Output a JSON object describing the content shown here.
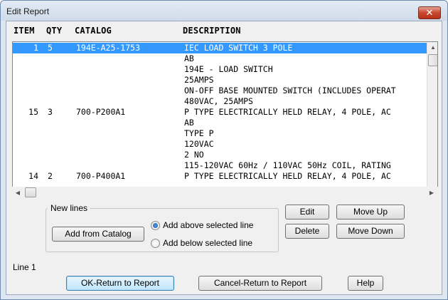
{
  "window": {
    "title": "Edit Report",
    "close_glyph": "✕"
  },
  "columns": {
    "item": "ITEM",
    "qty": "QTY",
    "catalog": "CATALOG",
    "description": "DESCRIPTION"
  },
  "rows": [
    {
      "item": "1",
      "qty": "5",
      "catalog": "194E-A25-1753",
      "description": "IEC LOAD SWITCH 3 POLE",
      "selected": true
    },
    {
      "item": "",
      "qty": "",
      "catalog": "",
      "description": "AB"
    },
    {
      "item": "",
      "qty": "",
      "catalog": "",
      "description": "194E - LOAD SWITCH"
    },
    {
      "item": "",
      "qty": "",
      "catalog": "",
      "description": "25AMPS"
    },
    {
      "item": "",
      "qty": "",
      "catalog": "",
      "description": "ON-OFF BASE MOUNTED SWITCH (INCLUDES OPERAT"
    },
    {
      "item": "",
      "qty": "",
      "catalog": "",
      "description": "480VAC, 25AMPS"
    },
    {
      "item": "15",
      "qty": "3",
      "catalog": "700-P200A1",
      "description": "P TYPE ELECTRICALLY HELD RELAY, 4 POLE, AC"
    },
    {
      "item": "",
      "qty": "",
      "catalog": "",
      "description": "AB"
    },
    {
      "item": "",
      "qty": "",
      "catalog": "",
      "description": "TYPE P"
    },
    {
      "item": "",
      "qty": "",
      "catalog": "",
      "description": "120VAC"
    },
    {
      "item": "",
      "qty": "",
      "catalog": "",
      "description": "2 NO"
    },
    {
      "item": "",
      "qty": "",
      "catalog": "",
      "description": "115-120VAC 60Hz / 110VAC 50Hz COIL, RATING"
    },
    {
      "item": "14",
      "qty": "2",
      "catalog": "700-P400A1",
      "description": "P TYPE ELECTRICALLY HELD RELAY, 4 POLE, AC"
    }
  ],
  "new_lines": {
    "label": "New lines",
    "add_from_catalog": "Add from Catalog",
    "add_above": "Add above selected line",
    "add_below": "Add below selected line",
    "selected_option": "add_above"
  },
  "actions": {
    "edit": "Edit",
    "move_up": "Move Up",
    "delete": "Delete",
    "move_down": "Move Down"
  },
  "status": "Line 1",
  "footer": {
    "ok": "OK-Return to Report",
    "cancel": "Cancel-Return to Report",
    "help": "Help"
  },
  "icons": {
    "scroll_up": "scroll-up-icon",
    "scroll_down": "scroll-down-icon",
    "scroll_left": "scroll-left-icon",
    "scroll_right": "scroll-right-icon"
  },
  "colors": {
    "selection": "#3399ff",
    "window_frame": "#dde6f1",
    "close_button": "#c9472f"
  }
}
